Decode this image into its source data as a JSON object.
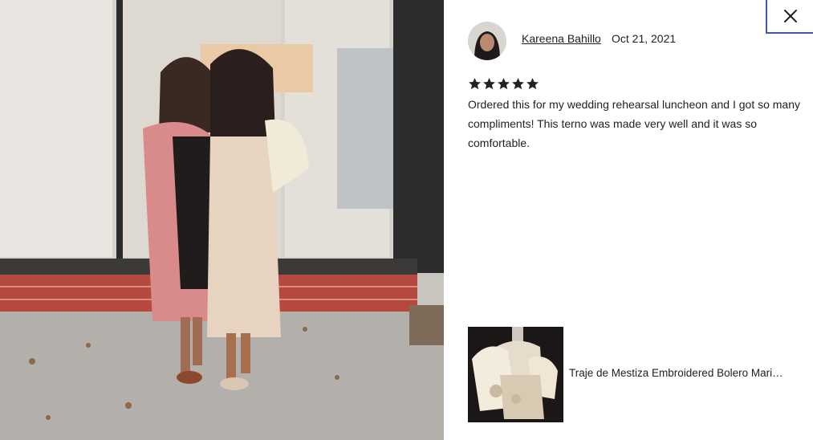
{
  "photo": {
    "icon": "review-photo"
  },
  "review": {
    "reviewer_name": "Kareena Bahillo",
    "date": "Oct 21, 2021",
    "rating": 5,
    "rating_max": 5,
    "text": "Ordered this for my wedding rehearsal luncheon and I got so many compliments! This terno was made very well and it was so comfortable."
  },
  "product": {
    "title": "Traje de Mestiza Embroidered Bolero Mari…"
  },
  "close": {
    "icon": "close-icon"
  },
  "colors": {
    "text": "#222222",
    "star": "#222222",
    "close_border": "#3b5ba9"
  }
}
